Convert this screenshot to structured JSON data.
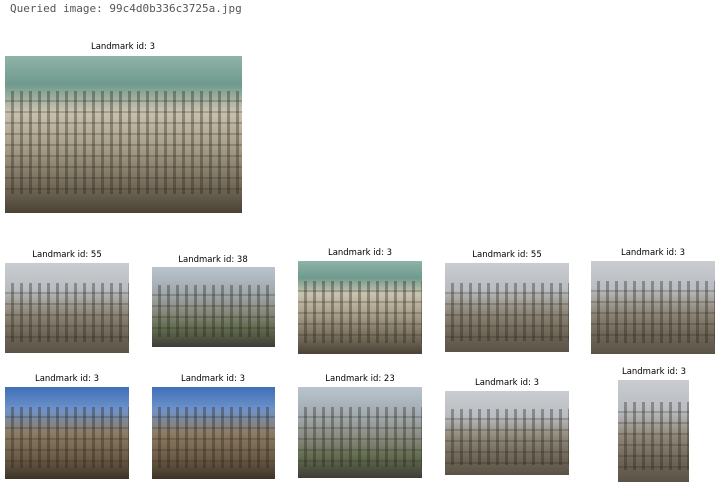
{
  "query": {
    "label": "Queried image: 99c4d0b336c3725a.jpg",
    "caption": "Landmark id: 3"
  },
  "results": [
    {
      "caption": "Landmark id: 55"
    },
    {
      "caption": "Landmark id: 38"
    },
    {
      "caption": "Landmark id: 3"
    },
    {
      "caption": "Landmark id: 55"
    },
    {
      "caption": "Landmark id: 3"
    },
    {
      "caption": "Landmark id: 3"
    },
    {
      "caption": "Landmark id: 3"
    },
    {
      "caption": "Landmark id: 23"
    },
    {
      "caption": "Landmark id: 3"
    },
    {
      "caption": "Landmark id: 3"
    }
  ]
}
